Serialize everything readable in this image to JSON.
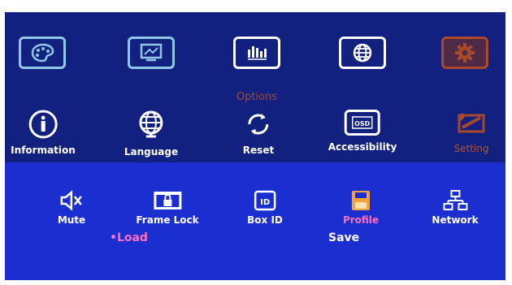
{
  "top_menu": {
    "selected_caption": "Options",
    "tabs": [
      {
        "icon": "palette-icon"
      },
      {
        "icon": "display-settings-icon"
      },
      {
        "icon": "options-icon"
      },
      {
        "icon": "globe-panel-icon"
      },
      {
        "icon": "gear-icon"
      }
    ]
  },
  "settings_menu": {
    "items": [
      {
        "label": "Information",
        "icon": "info-icon"
      },
      {
        "label": "Language",
        "icon": "globe-icon"
      },
      {
        "label": "Reset",
        "icon": "reset-icon"
      },
      {
        "label": "Accessibility",
        "icon": "osd-icon"
      },
      {
        "label": "Setting",
        "icon": "setting-icon"
      }
    ]
  },
  "submenu": {
    "items": [
      {
        "label": "Mute",
        "icon": "mute-icon"
      },
      {
        "label": "Frame Lock",
        "icon": "frame-lock-icon"
      },
      {
        "label": "Box ID",
        "icon": "id-icon"
      },
      {
        "label": "Profile",
        "icon": "save-icon"
      },
      {
        "label": "Network",
        "icon": "network-icon"
      }
    ]
  },
  "profile_actions": {
    "load": "•Load",
    "save": "Save"
  },
  "colors": {
    "panel": "#12207f",
    "band": "#1b2fd0",
    "highlight": "#ff6fc0",
    "inactive": "#b2542e",
    "accent_orange": "#f6a23b"
  }
}
